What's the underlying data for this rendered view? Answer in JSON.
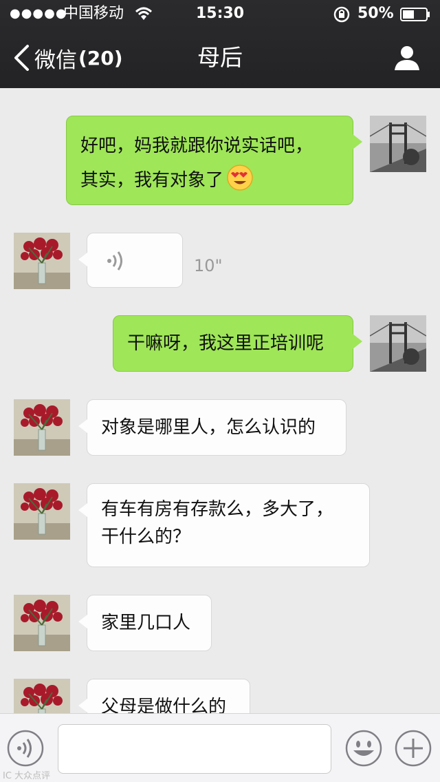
{
  "status_bar": {
    "signal": "●●●●●",
    "carrier": "中国移动",
    "time": "15:30",
    "battery_percent": "50%",
    "battery_level": 0.5,
    "icons": [
      "wifi-icon",
      "rotation-lock-icon",
      "battery-icon"
    ]
  },
  "nav": {
    "back_label": "微信",
    "unread_count": "(20)",
    "title": "母后",
    "icons": [
      "back-chevron-icon",
      "profile-icon"
    ]
  },
  "messages": [
    {
      "side": "sent",
      "type": "text",
      "lines": [
        "好吧，妈我就跟你说实话吧，",
        "其实，我有对象了"
      ],
      "emoji": "heart-eyes-emoji"
    },
    {
      "side": "recv",
      "type": "voice",
      "duration": "10\""
    },
    {
      "side": "sent",
      "type": "text",
      "lines": [
        "干嘛呀，我这里正培训呢"
      ]
    },
    {
      "side": "recv",
      "type": "text",
      "lines": [
        "对象是哪里人，怎么认识的"
      ]
    },
    {
      "side": "recv",
      "type": "text",
      "lines": [
        "有车有房有存款么，多大了，",
        "干什么的？"
      ]
    },
    {
      "side": "recv",
      "type": "text",
      "lines": [
        "家里几口人"
      ]
    },
    {
      "side": "recv",
      "type": "text",
      "lines": [
        "父母是做什么的"
      ]
    }
  ],
  "input_bar": {
    "input_value": "",
    "icons": [
      "voice-input-icon",
      "emoji-icon",
      "plus-icon"
    ]
  },
  "watermark": "IC 大众点评",
  "colors": {
    "header_bg": "#262628",
    "sent_bubble": "#9fe658",
    "recv_bubble": "#fdfdfd",
    "chat_bg": "#ebebeb"
  }
}
